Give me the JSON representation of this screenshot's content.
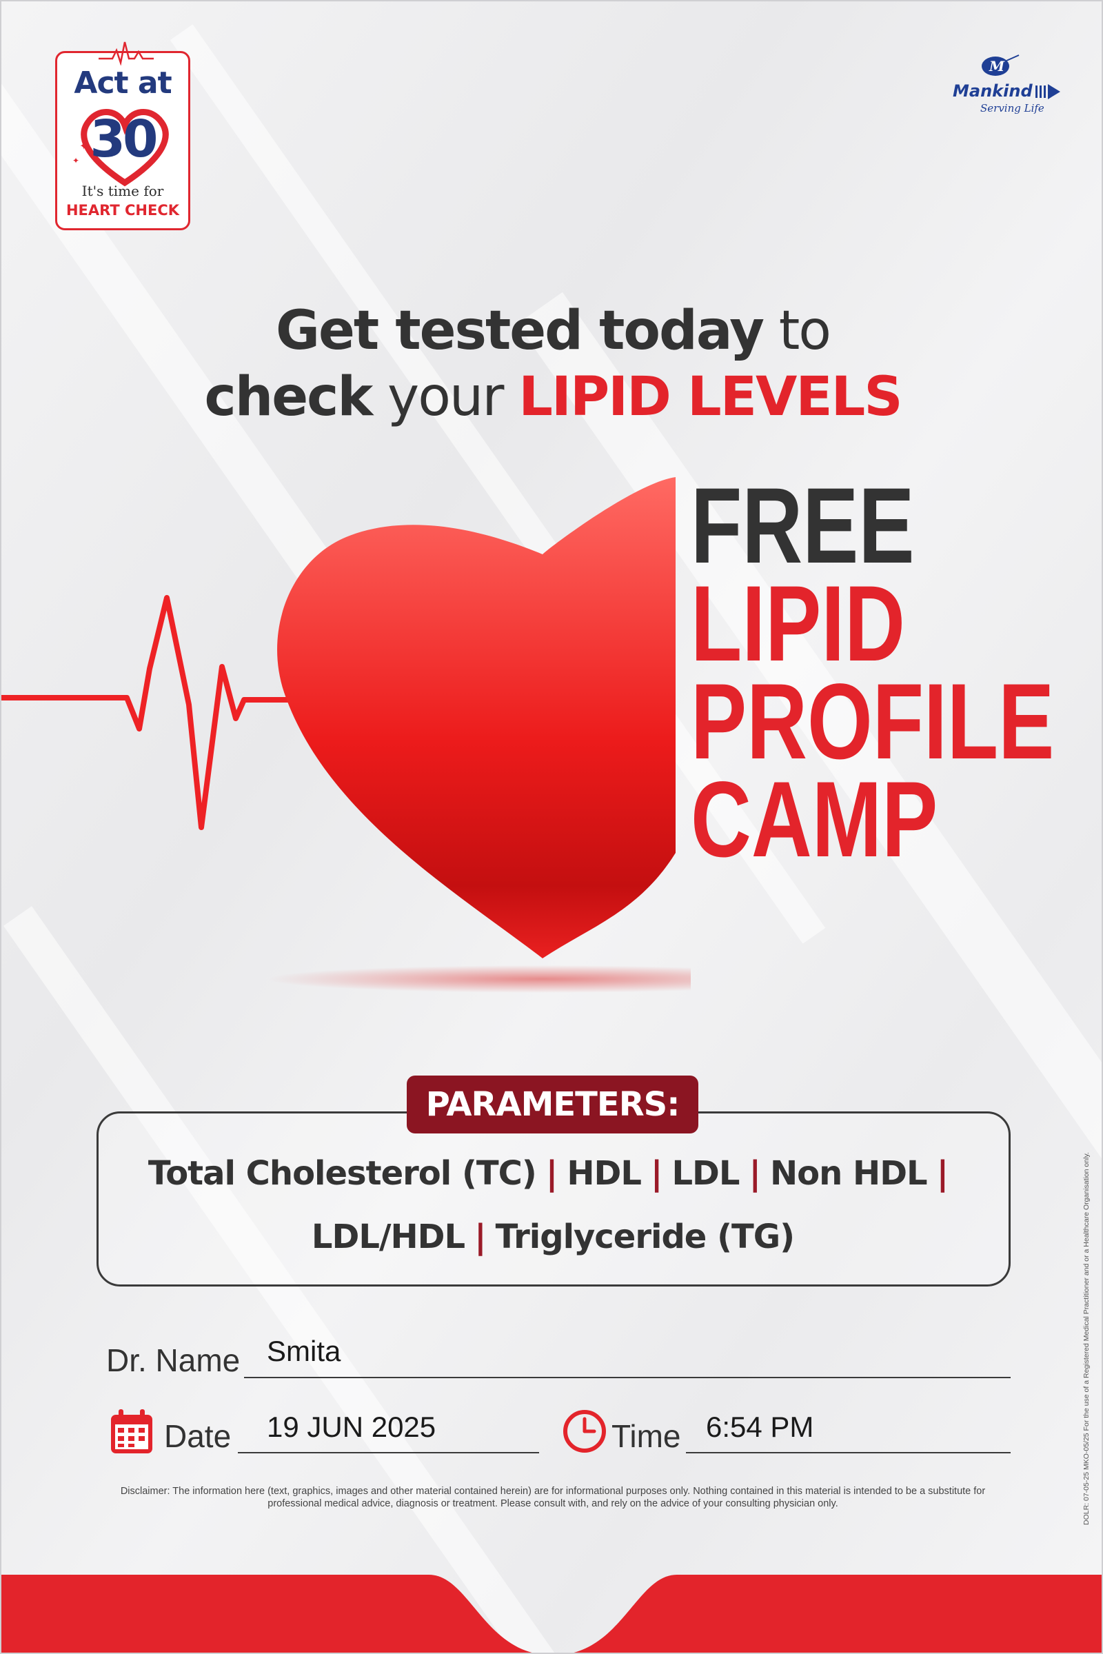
{
  "badge": {
    "title": "Act at",
    "number": "30",
    "tagline": "It's time for",
    "highlight": "HEART CHECK"
  },
  "brand": {
    "name": "Mankind",
    "tagline": "Serving Life"
  },
  "headline": {
    "line1_bold": "Get tested today",
    "line1_rest": " to",
    "line2_bold": "check",
    "line2_light": " your ",
    "line2_red": "LIPID LEVELS"
  },
  "camp_title": {
    "line1": "FREE",
    "line2": "LIPID",
    "line3": "PROFILE",
    "line4": "CAMP"
  },
  "parameters": {
    "heading": "PARAMETERS:",
    "row1": [
      "Total Cholesterol (TC)",
      "HDL",
      "LDL",
      "Non HDL"
    ],
    "row2": [
      "LDL/HDL",
      "Triglyceride (TG)"
    ],
    "separator": "|"
  },
  "form": {
    "doctor_label": "Dr. Name",
    "doctor_value": "Smita",
    "date_label": "Date",
    "date_value": "19 JUN 2025",
    "time_label": "Time",
    "time_value": "6:54 PM"
  },
  "disclaimer": "Disclaimer: The information here (text, graphics, images and other material contained herein) are for informational purposes only. Nothing contained in this material is intended to be a substitute for professional medical advice, diagnosis or treatment. Please consult with, and rely on the advice of your consulting physician only.",
  "side_note": "DOLR: 07-05-25   MKO-05/25      For the use of a Registered Medical Practitioner and or a Healthcare Organisation only.",
  "colors": {
    "brand_red": "#e3242b",
    "dark_text": "#333333",
    "maroon": "#8b1522",
    "navy": "#233a7e"
  },
  "icons": [
    "heart-icon",
    "pulse-line-icon",
    "calendar-icon",
    "clock-icon",
    "mankind-logo-icon"
  ]
}
